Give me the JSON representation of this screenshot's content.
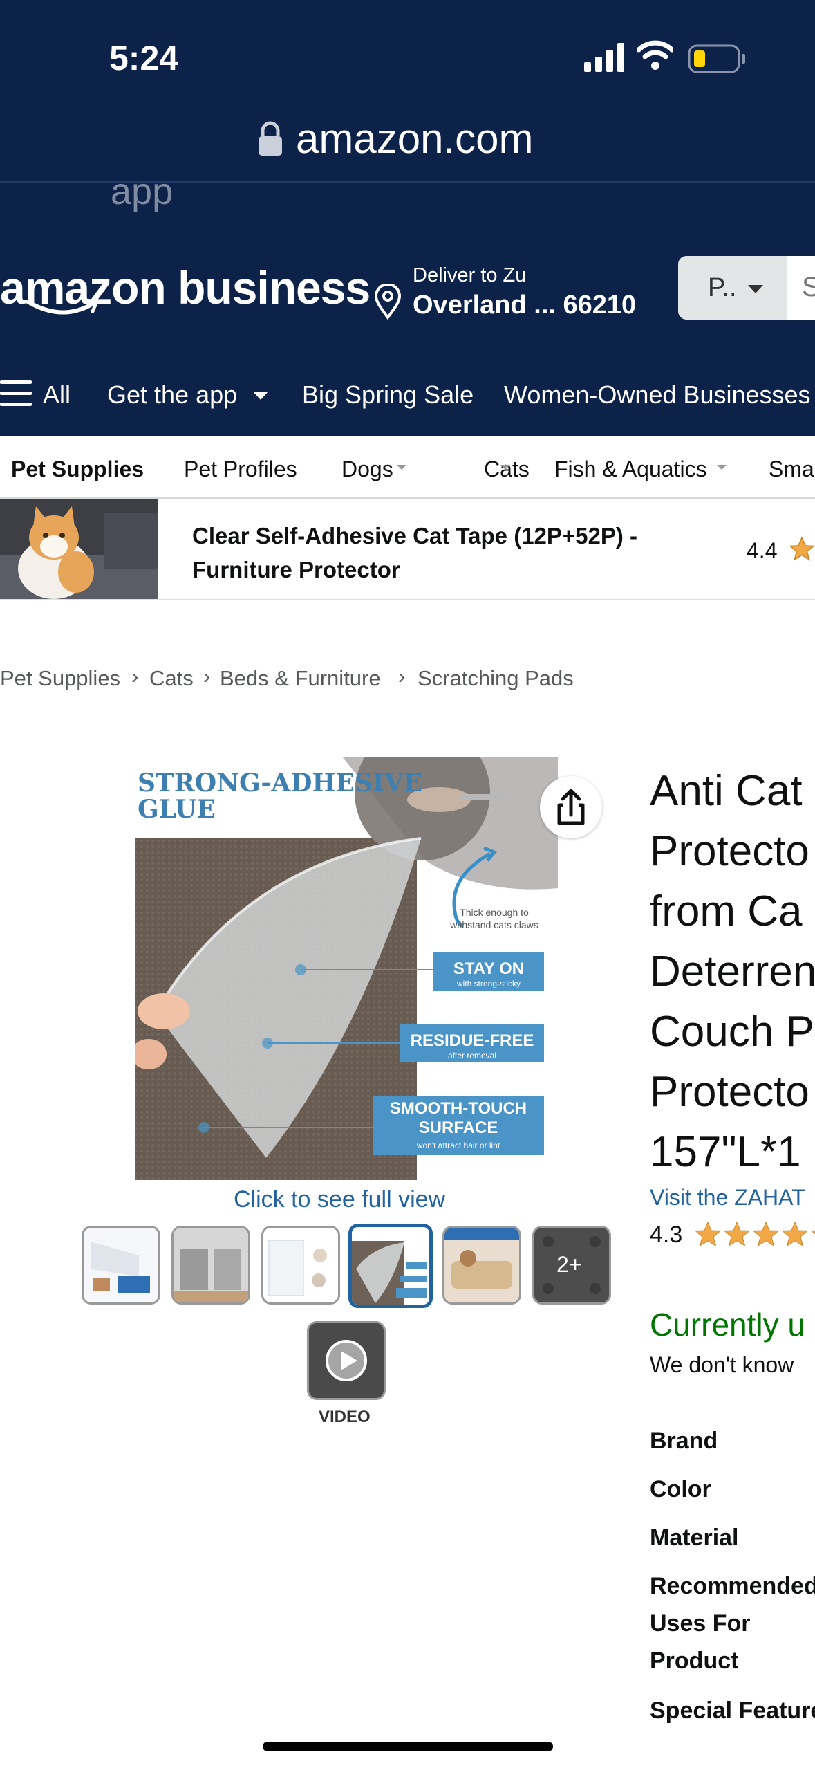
{
  "status_bar": {
    "time": "5:24"
  },
  "browser": {
    "url": "amazon.com",
    "ghost_text": "app"
  },
  "header": {
    "logo": "amazon business",
    "deliver_to": "Deliver to Zu",
    "deliver_location": "Overland ... 66210",
    "search_category": "P..",
    "search_placeholder": "S"
  },
  "nav": {
    "items": [
      "All",
      "Get the app",
      "Big Spring Sale",
      "Women-Owned Businesses"
    ]
  },
  "subnav": {
    "items": [
      "Pet Supplies",
      "Pet Profiles",
      "Dogs",
      "Cats",
      "Fish & Aquatics",
      "Sma"
    ]
  },
  "promo": {
    "title": "Clear Self-Adhesive Cat Tape (12P+52P) - Furniture Protector",
    "rating": "4.4"
  },
  "breadcrumb": [
    "Pet Supplies",
    "Cats",
    "Beds & Furniture",
    "Scratching Pads"
  ],
  "product_image": {
    "heading_line1": "STRONG-ADHESIVE",
    "heading_line2": "GLUE",
    "callout_thick": "Thick enough to",
    "callout_thick2": "withstand cats claws",
    "badge1_title": "STAY ON",
    "badge1_sub": "with strong-sticky",
    "badge2_title": "RESIDUE-FREE",
    "badge2_sub": "after removal",
    "badge3_title1": "SMOOTH-TOUCH",
    "badge3_title2": "SURFACE",
    "badge3_sub": "won't attract hair or lint",
    "click_full": "Click to see full view",
    "more_label": "2+",
    "video_label": "VIDEO"
  },
  "product": {
    "title_lines": [
      "Anti Cat",
      "Protecto",
      "from Ca",
      "Deterren",
      "Couch P",
      "Protecto",
      "157\"L*1"
    ],
    "visit_store": "Visit the ZAHAT",
    "rating": "4.3",
    "availability": "Currently u",
    "availability_note": "We don't know",
    "specs": [
      "Brand",
      "Color",
      "Material",
      "Recommended Uses For Product",
      "Special Feature"
    ]
  },
  "colors": {
    "header_bg": "#0D2248",
    "link": "#2162A1",
    "star": "#F3A847",
    "in_stock_green": "#007600",
    "badge_blue": "#4A94C8"
  }
}
